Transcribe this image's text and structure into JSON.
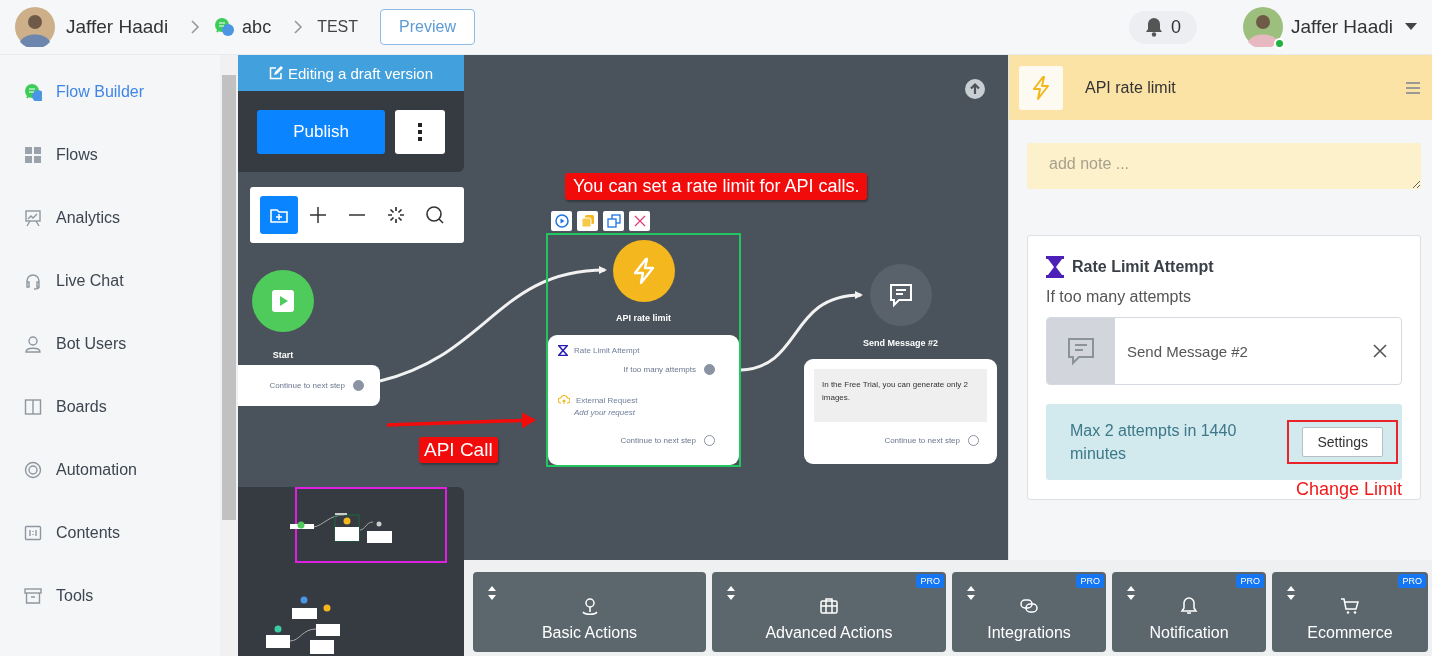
{
  "header": {
    "user_name": "Jaffer Haadi",
    "breadcrumb": [
      {
        "label": "abc",
        "kind": "bot"
      },
      {
        "label": "TEST",
        "kind": "flow"
      }
    ],
    "preview_button": "Preview",
    "notification_count": "0",
    "account_name": "Jaffer Haadi",
    "online": true
  },
  "sidebar": {
    "items": [
      {
        "label": "Flow Builder",
        "selected": true,
        "badge": false
      },
      {
        "label": "Flows",
        "selected": false,
        "badge": false
      },
      {
        "label": "Analytics",
        "selected": false,
        "badge": false
      },
      {
        "label": "Live Chat",
        "selected": false,
        "badge": false
      },
      {
        "label": "Bot Users",
        "selected": false,
        "badge": false
      },
      {
        "label": "Boards",
        "selected": false,
        "badge": false
      },
      {
        "label": "Automation",
        "selected": false,
        "badge": false
      },
      {
        "label": "Contents",
        "selected": false,
        "badge": false
      },
      {
        "label": "Tools",
        "selected": false,
        "badge": false
      }
    ]
  },
  "editor": {
    "banner": "Editing a draft version",
    "publish_button": "Publish",
    "toolbar": [
      {
        "selected": true
      },
      {
        "selected": false
      },
      {
        "selected": false
      },
      {
        "selected": false
      },
      {
        "selected": false
      }
    ]
  },
  "canvas": {
    "callouts": [
      {
        "kind": "banner",
        "text": "You can set a rate limit for API calls."
      },
      {
        "kind": "arrow",
        "text": "API Call"
      }
    ],
    "start_node": {
      "label": "Start",
      "output": "Continue to next step",
      "output_connected": true
    },
    "api_node": {
      "label": "API rate limit",
      "selected": true,
      "rows": [
        {
          "kind": "limit",
          "title": "Rate Limit Attempt",
          "output": "If too many attempts",
          "connected": true
        },
        {
          "kind": "request",
          "title": "External Request",
          "subtitle": "Add your request"
        }
      ],
      "output": "Continue to next step",
      "output_connected": false
    },
    "message_node": {
      "label": "Send Message #2",
      "message": "In the Free Trial, you can generate only 2 images.",
      "output": "Continue to next step",
      "output_connected": false
    }
  },
  "inspector": {
    "title": "API rate limit",
    "note_placeholder": "add note ...",
    "section_title": "Rate Limit Attempt",
    "section_subtitle": "If too many attempts",
    "linked_step": "Send Message #2",
    "limit_text": "Max 2 attempts in 1440 minutes",
    "settings_button": "Settings",
    "annotation": "Change Limit"
  },
  "action_groups": [
    {
      "label": "Basic Actions"
    },
    {
      "label": "Advanced Actions",
      "badge": "PRO"
    },
    {
      "label": "Integrations",
      "badge": "PRO"
    },
    {
      "label": "Notification",
      "badge": "PRO"
    },
    {
      "label": "Ecommerce",
      "badge": "PRO"
    }
  ]
}
